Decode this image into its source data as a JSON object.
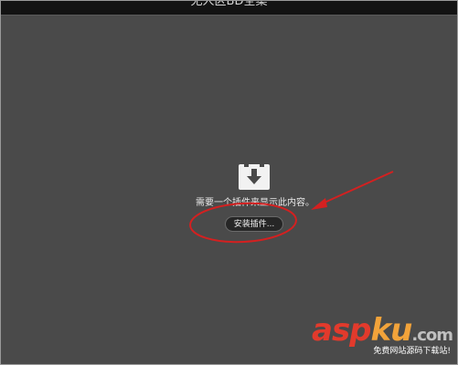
{
  "window": {
    "title": "无人区BD全集"
  },
  "plugin_placeholder": {
    "icon": "plugin-download-icon",
    "message": "需要一个插件来显示此内容。",
    "install_button_label": "安装插件..."
  },
  "annotation": {
    "color": "#d42020"
  },
  "watermark": {
    "brand_part1": "asp",
    "brand_part2": "ku",
    "brand_suffix": ".com",
    "tagline": "免费网站源码下载站!"
  },
  "colors": {
    "background": "#4a4a4a",
    "titlebar": "#131313",
    "button": "#262626"
  }
}
